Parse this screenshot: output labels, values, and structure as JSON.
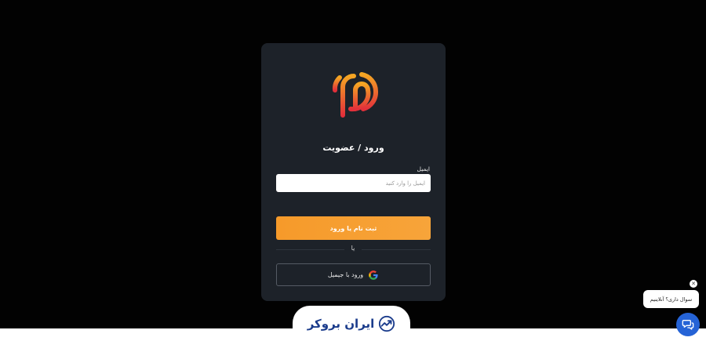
{
  "login_card": {
    "title": "ورود / عضویت",
    "email_label": "ایمیل",
    "email_placeholder": "ایمیل را وارد کنید",
    "email_value": "",
    "submit_label": "ثبت نام یا ورود",
    "divider_text": "یا",
    "google_label": "ورود با جیمیل",
    "logo_icon": "brand-logo-icon",
    "colors": {
      "card": "#1d2229",
      "accent": "#f69a2a",
      "logo_gradient_start": "#f5a623",
      "logo_gradient_end": "#e2303a"
    }
  },
  "footer": {
    "brand_name": "ایران بروکر",
    "brand_icon": "trend-chart-icon",
    "brand_color": "#1b3c8c"
  },
  "chat_widget": {
    "bubble_text": "سوال داری؟ آنلاینیم",
    "close_icon": "close-icon",
    "fab_icon": "chat-icon",
    "fab_color": "#2563d6"
  }
}
